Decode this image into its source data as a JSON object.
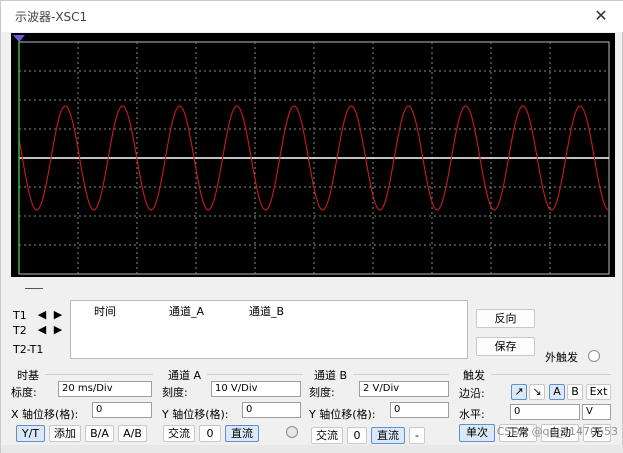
{
  "window": {
    "title": "示波器-XSC1",
    "close_glyph": "✕"
  },
  "colors": {
    "screen_bg": "#000000",
    "grid": "#8a8a8a",
    "channel_a": "#cc1b1b",
    "channel_b": "#ffffff",
    "t1_cursor": "#3ec33e",
    "border": "#c0c0c0"
  },
  "cursors": {
    "t1": "T1",
    "t2": "T2",
    "t2_t1": "T2-T1"
  },
  "readout": {
    "col_time": "时间",
    "col_a": "通道_A",
    "col_b": "通道_B"
  },
  "buttons": {
    "reverse": "反向",
    "save": "保存",
    "ext_trigger": "外触发"
  },
  "timebase": {
    "title": "时基",
    "scale_label": "标度:",
    "scale_value": "20 ms/Div",
    "xpos_label": "X 轴位移(格):",
    "xpos_value": "0",
    "modes": [
      "Y/T",
      "添加",
      "B/A",
      "A/B"
    ],
    "active_mode": "Y/T"
  },
  "channel_a": {
    "title": "通道 A",
    "scale_label": "刻度:",
    "scale_value": "10  V/Div",
    "ypos_label": "Y 轴位移(格):",
    "ypos_value": "0",
    "coupling": [
      "交流",
      "0",
      "直流"
    ],
    "active_coupling": "直流"
  },
  "channel_b": {
    "title": "通道 B",
    "scale_label": "刻度:",
    "scale_value": "2  V/Div",
    "ypos_label": "Y 轴位移(格):",
    "ypos_value": "0",
    "coupling": [
      "交流",
      "0",
      "直流",
      "-"
    ],
    "active_coupling": "直流"
  },
  "trigger": {
    "title": "触发",
    "edge_label": "边沿:",
    "edge_buttons": [
      "↗",
      "↘",
      "A",
      "B",
      "Ext"
    ],
    "level_label": "水平:",
    "level_value": "0",
    "level_unit": "V",
    "modes": [
      "单次",
      "正常",
      "自动",
      "无"
    ]
  },
  "watermark": "CSDN @qq_41470653"
}
